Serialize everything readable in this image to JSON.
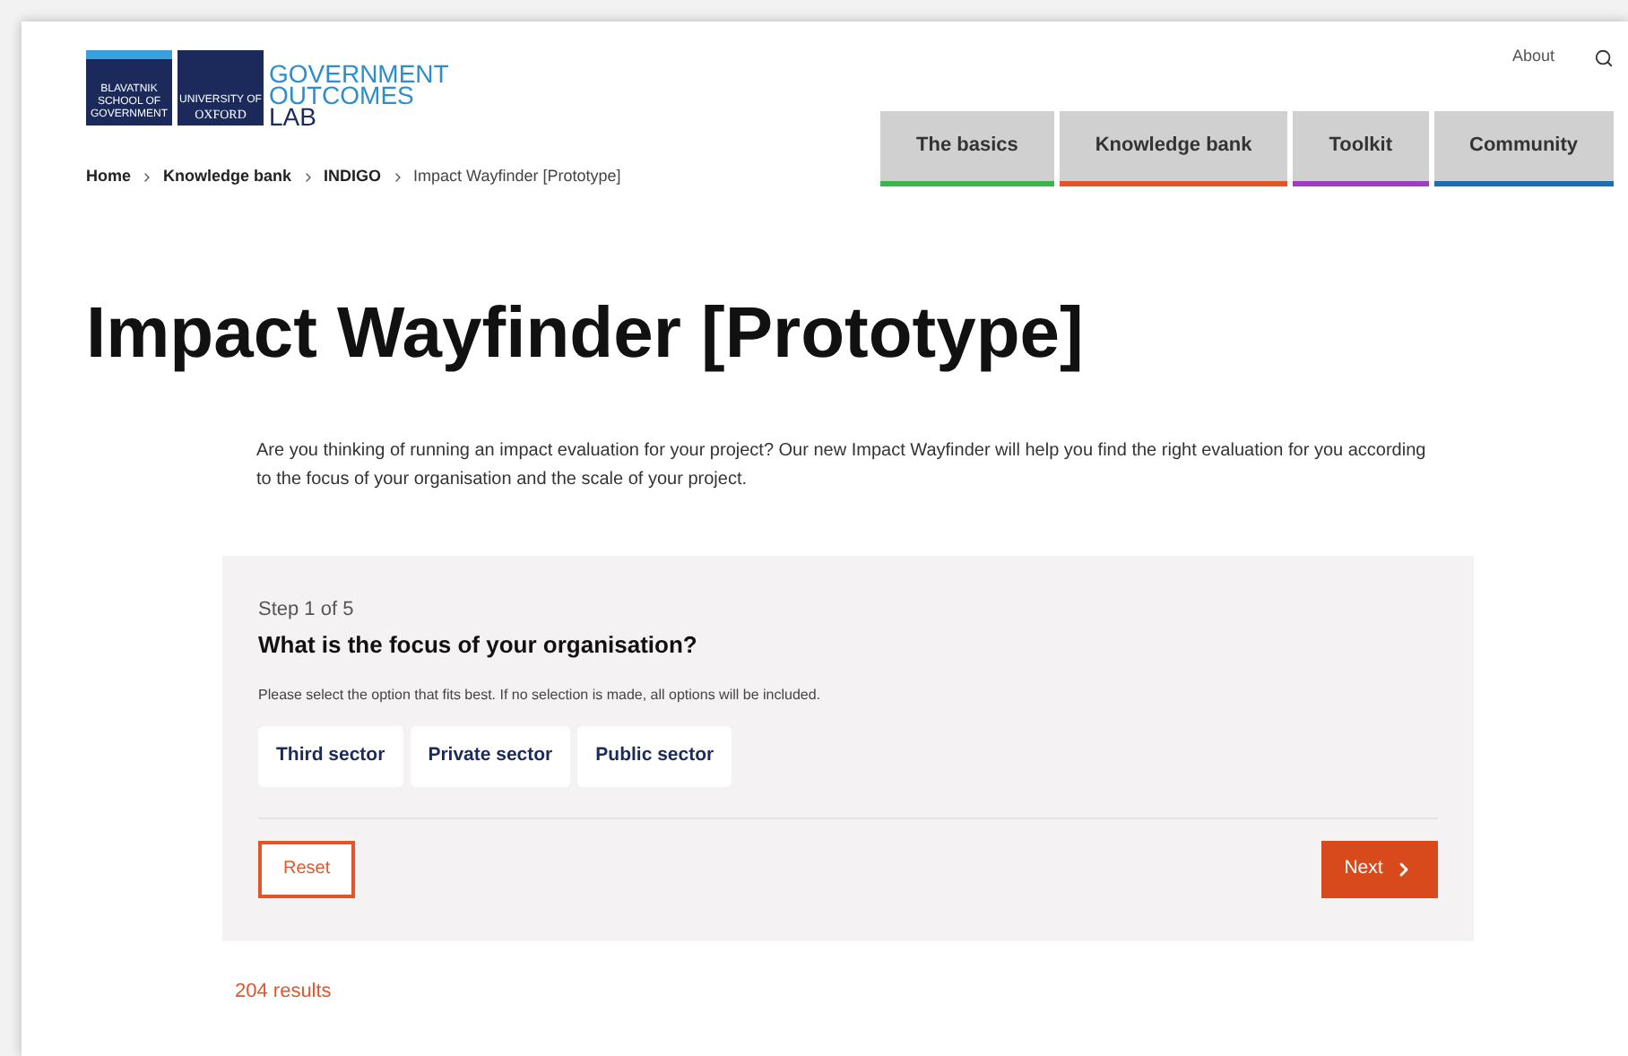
{
  "logo": {
    "school": "BLAVATNIK SCHOOL OF GOVERNMENT",
    "university_small": "UNIVERSITY OF",
    "university": "OXFORD",
    "lines": [
      "GOVERNMENT",
      "OUTCOMES",
      "LAB"
    ]
  },
  "top_links": [
    "About"
  ],
  "breadcrumb": [
    {
      "label": "Home",
      "current": false
    },
    {
      "label": "Knowledge bank",
      "current": false
    },
    {
      "label": "INDIGO",
      "current": false
    },
    {
      "label": "Impact Wayfinder [Prototype]",
      "current": true
    }
  ],
  "nav": [
    {
      "label": "The basics",
      "color": "#3cb44b"
    },
    {
      "label": "Knowledge bank",
      "color": "#e0552a"
    },
    {
      "label": "Toolkit",
      "color": "#9b3fbf"
    },
    {
      "label": "Community",
      "color": "#1d6fb0"
    }
  ],
  "title": "Impact Wayfinder [Prototype]",
  "intro": "Are you thinking of running an impact evaluation for your project? Our new Impact Wayfinder will help you find the right evaluation for you according to the focus of your organisation and the scale of your project.",
  "step": {
    "counter": "Step 1 of 5",
    "question": "What is the focus of your organisation?",
    "hint": "Please select the option that fits best. If no selection is made, all options will be included.",
    "options": [
      {
        "label": "Third sector",
        "selected": false
      },
      {
        "label": "Private sector",
        "selected": false
      },
      {
        "label": "Public sector",
        "selected": false
      }
    ],
    "reset": "Reset",
    "next": "Next"
  },
  "results": "204 results"
}
